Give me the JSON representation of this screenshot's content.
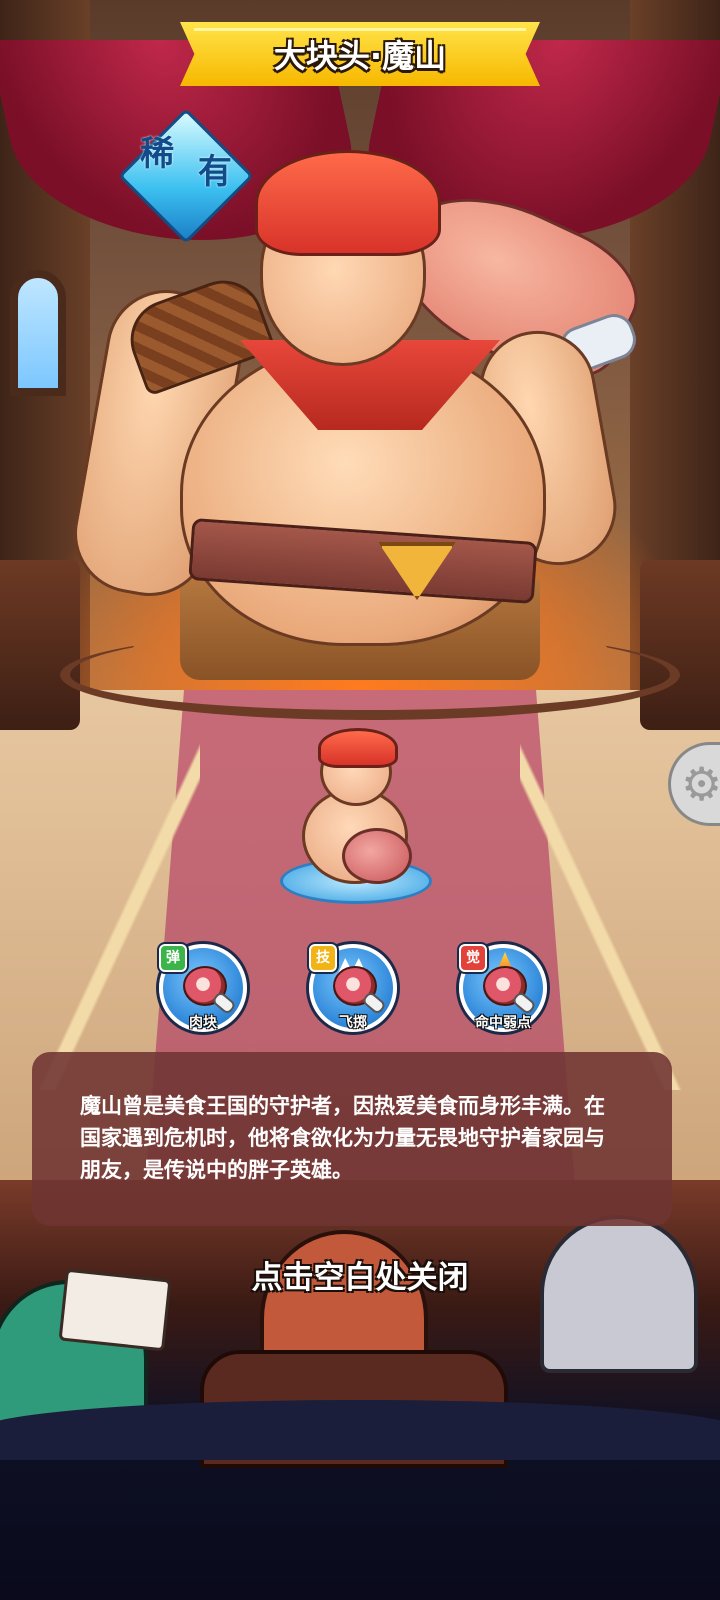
{
  "hero": {
    "title": "大块头·魔山",
    "rarity": [
      "稀",
      "有"
    ],
    "description": "魔山曾是美食王国的守护者，因热爱美食而身形丰满。在国家遇到危机时，他将食欲化为力量无畏地守护着家园与朋友，是传说中的胖子英雄。"
  },
  "skills": [
    {
      "tag": "弹",
      "label": "肉块",
      "tag_color": "#3bb54a",
      "icon": "meat-chunk-icon"
    },
    {
      "tag": "技",
      "label": "飞掷",
      "tag_color": "#f2b316",
      "icon": "flying-meat-icon"
    },
    {
      "tag": "觉",
      "label": "命中弱点",
      "tag_color": "#e2423a",
      "icon": "flaming-meat-icon"
    }
  ],
  "close_hint": "点击空白处关闭",
  "side_button": {
    "icon": "gear-icon"
  },
  "colors": {
    "banner": "#f7b800",
    "description_panel": "#6e3432",
    "carpet": "#c76b78",
    "skill_circle": "#2e86d8"
  }
}
